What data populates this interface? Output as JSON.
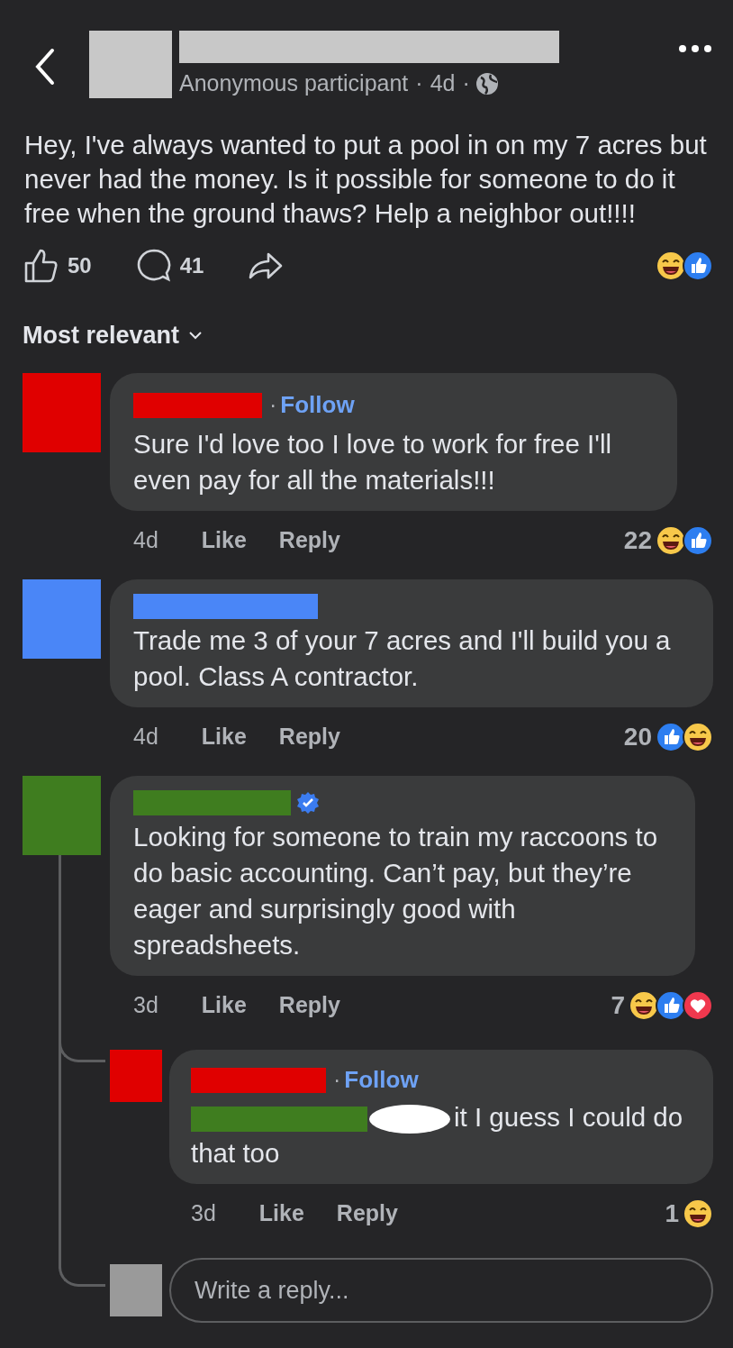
{
  "header": {
    "author": "Anonymous participant",
    "dot_1": "·",
    "time": "4d",
    "dot_2": "·"
  },
  "post": {
    "text": "Hey, I've always wanted to put a pool in on my 7 acres but never had the money. Is it possible for someone to do it free when the ground thaws? Help a neighbor out!!!!",
    "likes": "50",
    "comments": "41",
    "reactions": [
      {
        "kind": "haha"
      },
      {
        "kind": "like"
      }
    ]
  },
  "sort": {
    "label": "Most relevant"
  },
  "comments": [
    {
      "color": "#e00000",
      "dot": "·",
      "follow": "Follow",
      "text": "Sure I'd love too I love to work for free I'll even pay for all the materials!!!",
      "time": "4d",
      "like": "Like",
      "reply": "Reply",
      "count": "22",
      "reactions": [
        {
          "kind": "haha"
        },
        {
          "kind": "like"
        }
      ]
    },
    {
      "color": "#4a86f7",
      "text": "Trade me 3 of your 7 acres and I'll build you a pool. Class A contractor.",
      "time": "4d",
      "like": "Like",
      "reply": "Reply",
      "count": "20",
      "reactions": [
        {
          "kind": "like"
        },
        {
          "kind": "haha"
        }
      ]
    },
    {
      "color": "#3f7d1f",
      "verified": true,
      "text": "Looking for someone to train my raccoons to do basic accounting. Can’t pay, but they’re eager and surprisingly good with spreadsheets.",
      "time": "3d",
      "like": "Like",
      "reply": "Reply",
      "count": "7",
      "reactions": [
        {
          "kind": "haha"
        },
        {
          "kind": "like"
        },
        {
          "kind": "love"
        }
      ],
      "replies": [
        {
          "color": "#e00000",
          "dot": "·",
          "follow": "Follow",
          "text_parts": [
            {
              "kind": "redaction",
              "color": "#3f7d1f"
            },
            {
              "kind": "scribble"
            },
            {
              "kind": "text",
              "text": "it I guess I could do that too"
            }
          ],
          "time": "3d",
          "like": "Like",
          "reply": "Reply",
          "count": "1",
          "reactions": [
            {
              "kind": "haha"
            }
          ]
        }
      ]
    }
  ],
  "reply_field": {
    "placeholder": "Write a reply..."
  }
}
